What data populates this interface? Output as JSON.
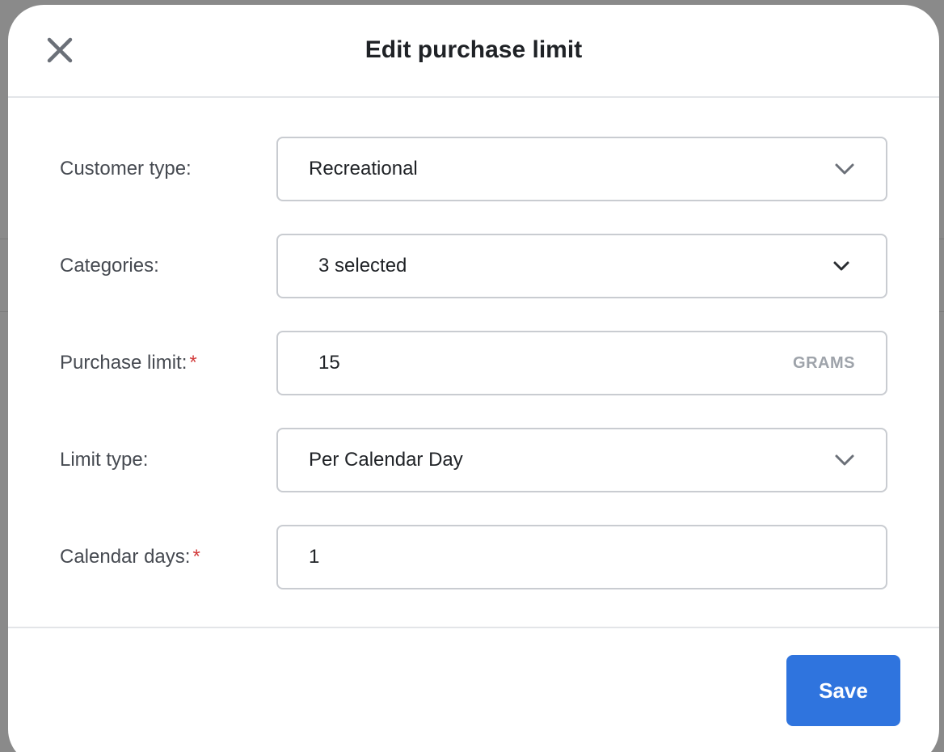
{
  "dialog": {
    "title": "Edit purchase limit",
    "close_icon": "close-icon"
  },
  "form": {
    "customer_type": {
      "label": "Customer type:",
      "value": "Recreational",
      "icon": "chevron-down-icon"
    },
    "categories": {
      "label": "Categories:",
      "value": "3 selected",
      "icon": "chevron-down-icon"
    },
    "purchase_limit": {
      "label": "Purchase limit:",
      "required_mark": "*",
      "value": "15",
      "unit": "GRAMS"
    },
    "limit_type": {
      "label": "Limit type:",
      "value": "Per Calendar Day",
      "icon": "chevron-down-icon"
    },
    "calendar_days": {
      "label": "Calendar days:",
      "required_mark": "*",
      "value": "1"
    }
  },
  "footer": {
    "save_label": "Save"
  },
  "colors": {
    "primary": "#2f74de",
    "required": "#d23a3a",
    "border": "#c9ccd1",
    "title_text": "#1f2226",
    "label_text": "#464a51",
    "muted_text": "#9ea3aa"
  }
}
